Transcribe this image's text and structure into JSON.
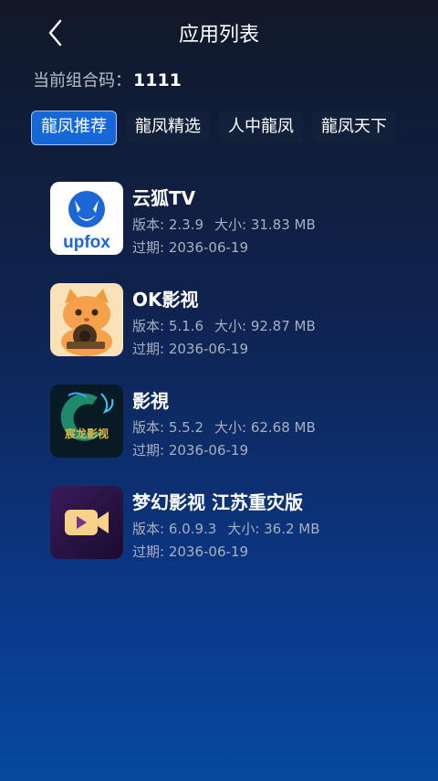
{
  "header": {
    "title": "应用列表",
    "back_icon": "chevron-left-icon"
  },
  "group_code": {
    "label": "当前组合码：",
    "value": "1111"
  },
  "tabs": [
    {
      "label": "龍凤推荐",
      "active": true
    },
    {
      "label": "龍凤精选",
      "active": false
    },
    {
      "label": "人中龍凤",
      "active": false
    },
    {
      "label": "龍凤天下",
      "active": false
    }
  ],
  "apps": [
    {
      "name": "云狐TV",
      "version": "版本: 2.3.9",
      "size": "大小: 31.83 MB",
      "expire": "过期: 2036-06-19",
      "icon": "upfox-logo-icon",
      "logo_text": "upfox"
    },
    {
      "name": "OK影视",
      "version": "版本: 5.1.6",
      "size": "大小: 92.87 MB",
      "expire": "过期: 2036-06-19",
      "icon": "orange-cat-icon"
    },
    {
      "name": "影視",
      "version": "版本: 5.5.2",
      "size": "大小: 62.68 MB",
      "expire": "过期: 2036-06-19",
      "icon": "dragon-logo-icon",
      "logo_text": "宸龙影视"
    },
    {
      "name": "梦幻影视 江苏重灾版",
      "version": "版本: 6.0.9.3",
      "size": "大小: 36.2 MB",
      "expire": "过期: 2036-06-19",
      "icon": "video-camera-icon"
    }
  ],
  "colors": {
    "accent": "#1668d8",
    "tab_bg": "#13203a",
    "meta_text": "#a9b0bd"
  }
}
